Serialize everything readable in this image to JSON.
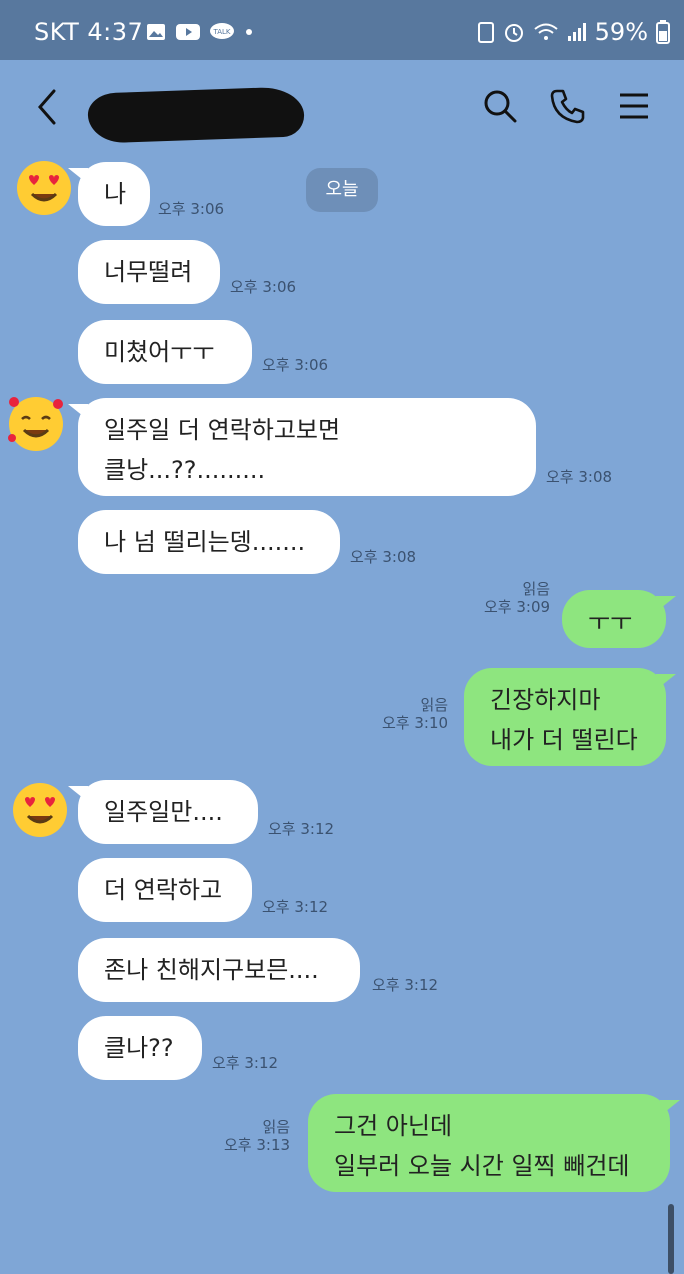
{
  "status": {
    "carrier_time": "SKT 4:37",
    "battery": "59%"
  },
  "header": {
    "back_icon": "chevron-left-icon",
    "icons": [
      "search-icon",
      "phone-icon",
      "menu-icon"
    ]
  },
  "chat": {
    "date_chip": "오늘",
    "messages": [
      {
        "side": "left",
        "text": "나",
        "time": "오후 3:06"
      },
      {
        "side": "left",
        "text": "너무떨려",
        "time": "오후 3:06"
      },
      {
        "side": "left",
        "text": "미쳤어ㅜㅜ",
        "time": "오후 3:06"
      },
      {
        "side": "left",
        "text": "일주일 더 연락하고보면\n클낭...??.........",
        "time": "오후 3:08"
      },
      {
        "side": "left",
        "text": "나 넘 떨리는뎅.......",
        "time": "오후 3:08"
      },
      {
        "side": "right",
        "text": "ㅜㅜ",
        "time": "오후 3:09",
        "read": "읽음"
      },
      {
        "side": "right",
        "text": "긴장하지마\n내가 더 떨린다",
        "time": "오후 3:10",
        "read": "읽음"
      },
      {
        "side": "left",
        "text": "일주일만....",
        "time": "오후 3:12"
      },
      {
        "side": "left",
        "text": "더 연락하고",
        "time": "오후 3:12"
      },
      {
        "side": "left",
        "text": "존나 친해지구보믄....",
        "time": "오후 3:12"
      },
      {
        "side": "left",
        "text": "클나??",
        "time": "오후 3:12"
      },
      {
        "side": "right",
        "text": "그건 아닌데\n일부러 오늘 시간 일찍 빼건데",
        "time": "오후 3:13",
        "read": "읽음"
      }
    ]
  }
}
